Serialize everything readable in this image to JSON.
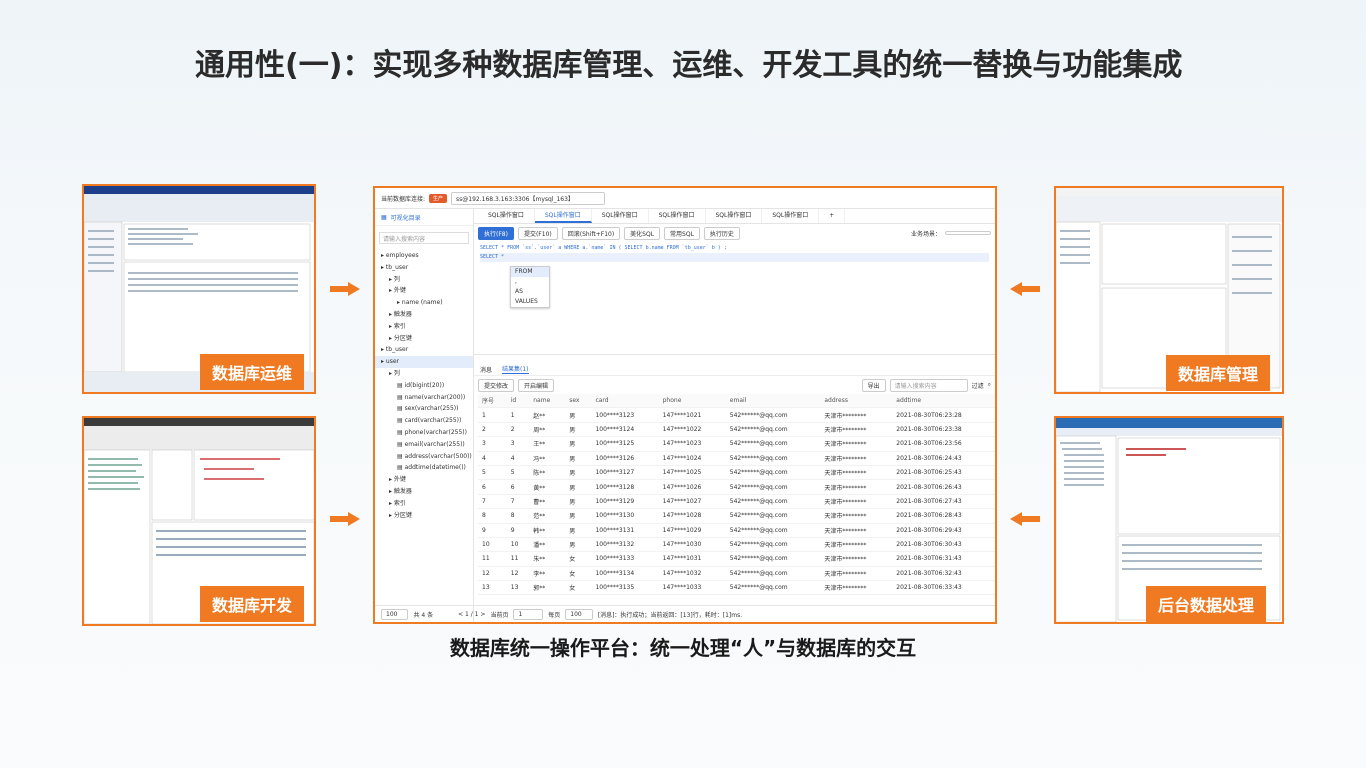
{
  "slide": {
    "title": "通用性(一)：实现多种数据库管理、运维、开发工具的统一替换与功能集成",
    "caption": "数据库统一操作平台：统一处理“人”与数据库的交互"
  },
  "badges": {
    "ops": "数据库运维",
    "dev": "数据库开发",
    "mgmt": "数据库管理",
    "backend": "后台数据处理"
  },
  "colors": {
    "accent": "#f07a22",
    "primary": "#2f6fd6"
  },
  "window": {
    "conn_label": "当前数据库连接:",
    "env_tag": "生产",
    "conn_value": "ss@192.168.3.163:3306【mysql_163】",
    "left_tab": "可视化目录",
    "search_placeholder": "请输入搜索内容",
    "tree": [
      "employees",
      "tb_user",
      "列",
      "外键",
      "name (name)",
      "触发器",
      "索引",
      "分区键",
      "tb_user",
      "user",
      "列",
      "id(bigint(20))",
      "name(varchar(200))",
      "sex(varchar(255))",
      "card(varchar(255))",
      "phone(varchar(255))",
      "email(varchar(255))",
      "address(varchar(500))",
      "addtime(datetime())",
      "外键",
      "触发器",
      "索引",
      "分区键"
    ],
    "tabs": [
      "SQL操作窗口",
      "SQL操作窗口",
      "SQL操作窗口",
      "SQL操作窗口",
      "SQL操作窗口",
      "SQL操作窗口"
    ],
    "toolbar": [
      "执行(F8)",
      "提交(F10)",
      "回滚(Shift+F10)",
      "美化SQL",
      "常用SQL",
      "执行历史"
    ],
    "biz_label": "业务场景：",
    "code_line1": "SELECT * FROM `ss`.`user` a WHERE a.`name` IN ( SELECT  b.name FROM `tb_user` b ) ;",
    "code_line2": "SELECT *",
    "autocomplete": [
      "FROM",
      ",",
      "AS",
      "VALUES"
    ],
    "result_tabs": [
      "消息",
      "结果集(1)"
    ],
    "result_tools": [
      "提交修改",
      "开启编辑"
    ],
    "export_label": "导出",
    "filter_placeholder": "请输入搜索内容",
    "filter_btn": "过滤",
    "columns": [
      "序号",
      "id",
      "name",
      "sex",
      "card",
      "phone",
      "email",
      "address",
      "addtime"
    ],
    "rows": [
      [
        "1",
        "1",
        "赵**",
        "男",
        "100****3123",
        "147****1021",
        "542******@qq.com",
        "天津市********",
        "2021-08-30T06:23:28"
      ],
      [
        "2",
        "2",
        "周**",
        "男",
        "100****3124",
        "147****1022",
        "542******@qq.com",
        "天津市********",
        "2021-08-30T06:23:38"
      ],
      [
        "3",
        "3",
        "王**",
        "男",
        "100****3125",
        "147****1023",
        "542******@qq.com",
        "天津市********",
        "2021-08-30T06:23:56"
      ],
      [
        "4",
        "4",
        "冯**",
        "男",
        "100****3126",
        "147****1024",
        "542******@qq.com",
        "天津市********",
        "2021-08-30T06:24:43"
      ],
      [
        "5",
        "5",
        "陈**",
        "男",
        "100****3127",
        "147****1025",
        "542******@qq.com",
        "天津市********",
        "2021-08-30T06:25:43"
      ],
      [
        "6",
        "6",
        "黄**",
        "男",
        "100****3128",
        "147****1026",
        "542******@qq.com",
        "天津市********",
        "2021-08-30T06:26:43"
      ],
      [
        "7",
        "7",
        "曹**",
        "男",
        "100****3129",
        "147****1027",
        "542******@qq.com",
        "天津市********",
        "2021-08-30T06:27:43"
      ],
      [
        "8",
        "8",
        "范**",
        "男",
        "100****3130",
        "147****1028",
        "542******@qq.com",
        "天津市********",
        "2021-08-30T06:28:43"
      ],
      [
        "9",
        "9",
        "韩**",
        "男",
        "100****3131",
        "147****1029",
        "542******@qq.com",
        "天津市********",
        "2021-08-30T06:29:43"
      ],
      [
        "10",
        "10",
        "潘**",
        "男",
        "100****3132",
        "147****1030",
        "542******@qq.com",
        "天津市********",
        "2021-08-30T06:30:43"
      ],
      [
        "11",
        "11",
        "朱**",
        "女",
        "100****3133",
        "147****1031",
        "542******@qq.com",
        "天津市********",
        "2021-08-30T06:31:43"
      ],
      [
        "12",
        "12",
        "李**",
        "女",
        "100****3134",
        "147****1032",
        "542******@qq.com",
        "天津市********",
        "2021-08-30T06:32:43"
      ],
      [
        "13",
        "13",
        "郭**",
        "女",
        "100****3135",
        "147****1033",
        "542******@qq.com",
        "天津市********",
        "2021-08-30T06:33:43"
      ]
    ],
    "footer": {
      "page_size": "100",
      "total": "共 4 条",
      "pager": "< 1 / 1 >",
      "cur_page_label": "当前页",
      "cur_page": "1",
      "per_page_label": "每页",
      "per_page": "100",
      "status": "[消息]：执行成功；当前返回：[13]行，耗时：[1]ms."
    }
  }
}
